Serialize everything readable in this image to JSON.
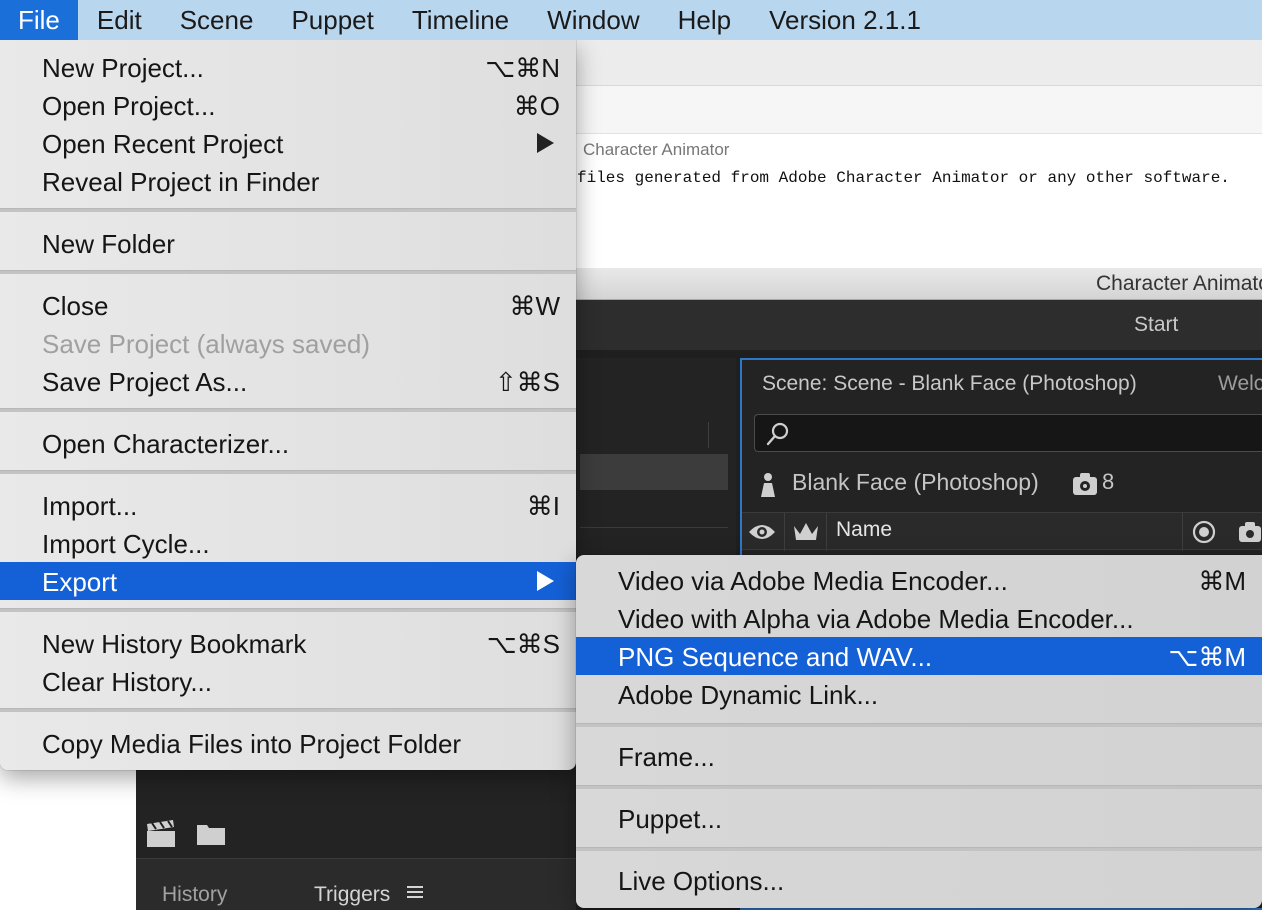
{
  "menubar": {
    "items": [
      "File",
      "Edit",
      "Scene",
      "Puppet",
      "Timeline",
      "Window",
      "Help",
      "Version 2.1.1"
    ]
  },
  "document": {
    "source": "Character Animator",
    "text": "files generated from Adobe Character Animator or any other software."
  },
  "app": {
    "title": "Character Animator",
    "start_label": "Start",
    "scene_header": "Scene: Scene - Blank Face (Photoshop)",
    "scene_tab2": "Welc",
    "puppet_name": "Blank Face (Photoshop)",
    "puppet_count": "8",
    "column_name": "Name",
    "tabs": {
      "history": "History",
      "triggers": "Triggers"
    }
  },
  "file_menu": {
    "items": [
      {
        "label": "New Project...",
        "shortcut": "⌥⌘N"
      },
      {
        "label": "Open Project...",
        "shortcut": "⌘O"
      },
      {
        "label": "Open Recent Project",
        "submenu": true
      },
      {
        "label": "Reveal Project in Finder"
      },
      {
        "label": "New Folder"
      },
      {
        "label": "Close",
        "shortcut": "⌘W"
      },
      {
        "label": "Save Project (always saved)",
        "disabled": true
      },
      {
        "label": "Save Project As...",
        "shortcut": "⇧⌘S"
      },
      {
        "label": "Open Characterizer..."
      },
      {
        "label": "Import...",
        "shortcut": "⌘I"
      },
      {
        "label": "Import Cycle..."
      },
      {
        "label": "Export",
        "submenu": true,
        "highlighted": true
      },
      {
        "label": "New History Bookmark",
        "shortcut": "⌥⌘S"
      },
      {
        "label": "Clear History..."
      },
      {
        "label": "Copy Media Files into Project Folder"
      }
    ]
  },
  "export_menu": {
    "items": [
      {
        "label": "Video via Adobe Media Encoder...",
        "shortcut": "⌘M"
      },
      {
        "label": "Video with Alpha via Adobe Media Encoder..."
      },
      {
        "label": "PNG Sequence and WAV...",
        "shortcut": "⌥⌘M",
        "highlighted": true
      },
      {
        "label": "Adobe Dynamic Link..."
      },
      {
        "label": "Frame..."
      },
      {
        "label": "Puppet..."
      },
      {
        "label": "Live Options..."
      }
    ]
  },
  "colors": {
    "menubar": "#b9d6ef",
    "highlight": "#1460d6",
    "panel_border": "#2c78c9"
  }
}
